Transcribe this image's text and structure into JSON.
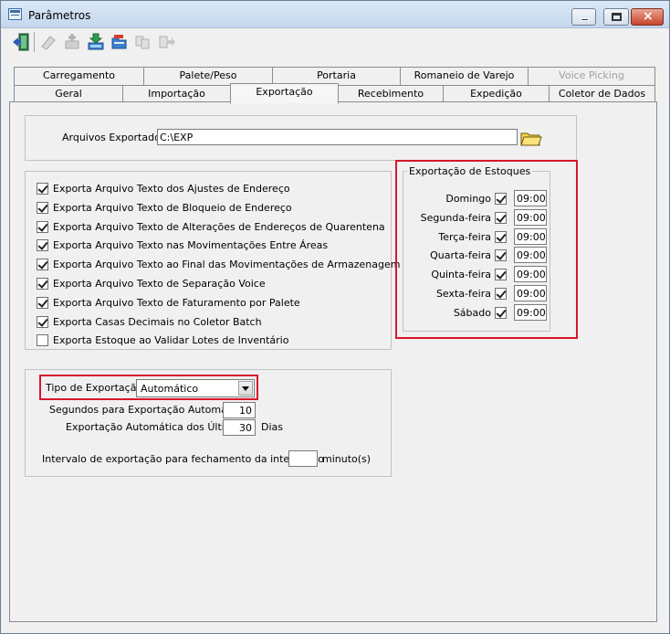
{
  "window": {
    "title": "Parâmetros"
  },
  "toolbar": {
    "icons": [
      "exit-door-icon",
      "eraser-icon",
      "add-record-icon",
      "download-tray-icon",
      "open-folder-icon",
      "copy-forward-icon",
      "next-arrow-icon"
    ]
  },
  "tabs": {
    "row1": [
      "Carregamento",
      "Palete/Peso",
      "Portaria",
      "Romaneio de Varejo",
      "Voice Picking"
    ],
    "row2": [
      "Geral",
      "Importação",
      "Exportação",
      "Recebimento",
      "Expedição",
      "Coletor de Dados"
    ],
    "active": "Exportação"
  },
  "arquivos": {
    "label": "Arquivos Exportados",
    "value": "C:\\EXP"
  },
  "exports": [
    {
      "label": "Exporta Arquivo Texto dos Ajustes de Endereço",
      "checked": true
    },
    {
      "label": "Exporta Arquivo Texto de Bloqueio de Endereço",
      "checked": true
    },
    {
      "label": "Exporta Arquivo Texto de Alterações de Endereços de Quarentena",
      "checked": true
    },
    {
      "label": "Exporta Arquivo Texto nas Movimentações Entre Áreas",
      "checked": true
    },
    {
      "label": "Exporta Arquivo Texto ao Final das Movimentações de Armazenagem",
      "checked": true
    },
    {
      "label": "Exporta Arquivo Texto de Separação Voice",
      "checked": true
    },
    {
      "label": "Exporta Arquivo Texto de Faturamento por Palete",
      "checked": true
    },
    {
      "label": "Exporta Casas Decimais no Coletor Batch",
      "checked": true
    },
    {
      "label": "Exporta Estoque ao Validar Lotes de Inventário",
      "checked": false
    }
  ],
  "estoques": {
    "title": "Exportação de Estoques",
    "days": [
      {
        "label": "Domingo",
        "checked": true,
        "time": "09:00"
      },
      {
        "label": "Segunda-feira",
        "checked": true,
        "time": "09:00"
      },
      {
        "label": "Terça-feira",
        "checked": true,
        "time": "09:00"
      },
      {
        "label": "Quarta-feira",
        "checked": true,
        "time": "09:00"
      },
      {
        "label": "Quinta-feira",
        "checked": true,
        "time": "09:00"
      },
      {
        "label": "Sexta-feira",
        "checked": true,
        "time": "09:00"
      },
      {
        "label": "Sábado",
        "checked": true,
        "time": "09:00"
      }
    ]
  },
  "tipo": {
    "label": "Tipo de Exportação",
    "value": "Automático",
    "segundos_label": "Segundos para Exportação Automática",
    "segundos_value": "10",
    "ultimos_label": "Exportação Automática dos Últimos",
    "ultimos_value": "30",
    "ultimos_unit": "Dias",
    "intervalo_label": "Intervalo de exportação para fechamento da integração",
    "intervalo_value": "",
    "intervalo_unit": "minuto(s)"
  },
  "colors": {
    "highlight": "#d7172b",
    "folder": "#f5d142"
  }
}
